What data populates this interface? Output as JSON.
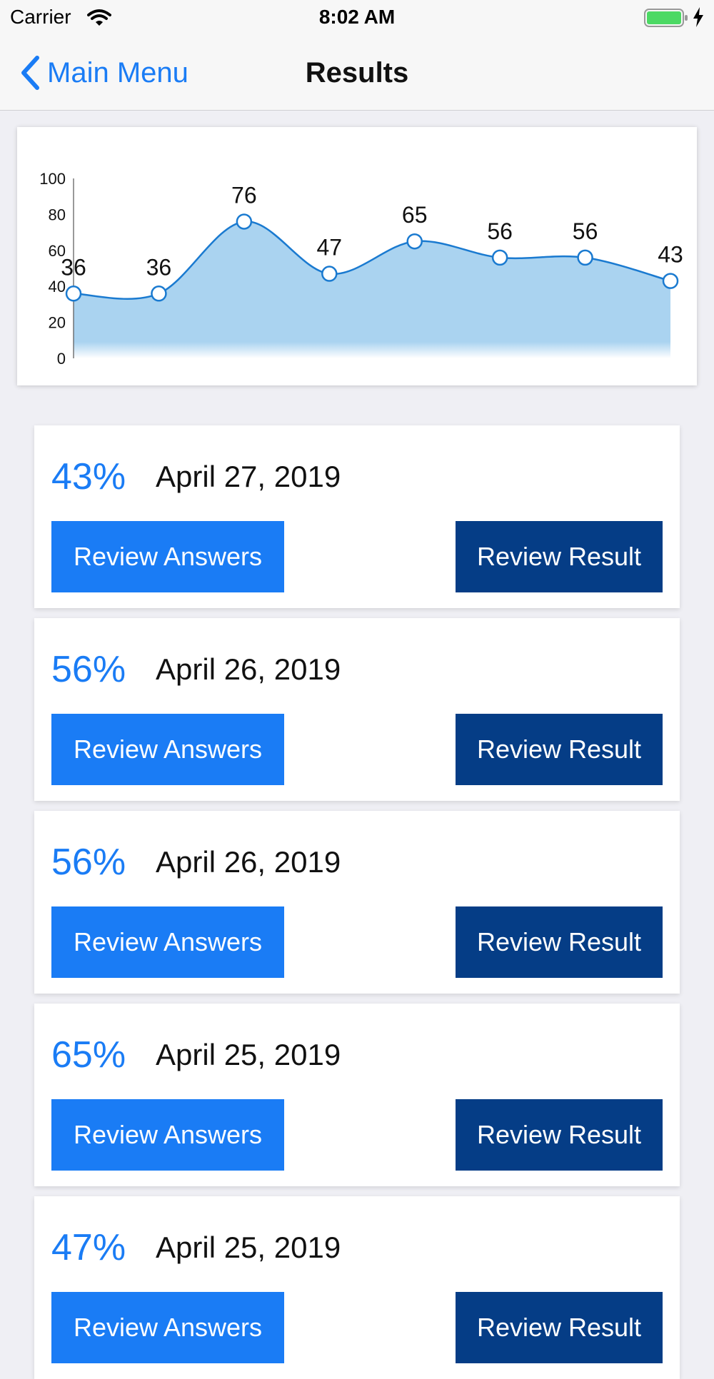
{
  "status_bar": {
    "carrier": "Carrier",
    "time": "8:02 AM"
  },
  "nav": {
    "back_label": "Main Menu",
    "title": "Results"
  },
  "colors": {
    "accent": "#1a7cf5",
    "dark_button": "#053d86",
    "chart_fill": "#aad3f0",
    "chart_line": "#1a7ad0"
  },
  "chart_data": {
    "type": "area",
    "title": "",
    "xlabel": "",
    "ylabel": "",
    "y_ticks": [
      "0",
      "20",
      "40",
      "60",
      "80",
      "100"
    ],
    "ylim": [
      0,
      100
    ],
    "values": [
      36,
      36,
      76,
      47,
      65,
      56,
      56,
      43
    ],
    "data_labels": [
      "36",
      "36",
      "76",
      "47",
      "65",
      "56",
      "56",
      "43"
    ],
    "grid": false
  },
  "results": [
    {
      "score": "43%",
      "date": "April 27, 2019",
      "answers_label": "Review Answers",
      "result_label": "Review Result"
    },
    {
      "score": "56%",
      "date": "April 26, 2019",
      "answers_label": "Review Answers",
      "result_label": "Review Result"
    },
    {
      "score": "56%",
      "date": "April 26, 2019",
      "answers_label": "Review Answers",
      "result_label": "Review Result"
    },
    {
      "score": "65%",
      "date": "April 25, 2019",
      "answers_label": "Review Answers",
      "result_label": "Review Result"
    },
    {
      "score": "47%",
      "date": "April 25, 2019",
      "answers_label": "Review Answers",
      "result_label": "Review Result"
    }
  ]
}
